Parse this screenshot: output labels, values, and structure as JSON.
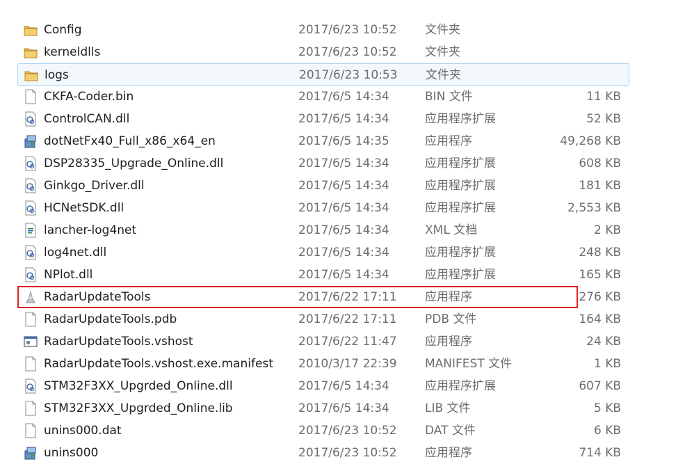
{
  "files": [
    {
      "name": "Config",
      "date": "2017/6/23 10:52",
      "type": "文件夹",
      "size": "",
      "icon": "folder-icon"
    },
    {
      "name": "kerneldlls",
      "date": "2017/6/23 10:52",
      "type": "文件夹",
      "size": "",
      "icon": "folder-icon"
    },
    {
      "name": "logs",
      "date": "2017/6/23 10:53",
      "type": "文件夹",
      "size": "",
      "icon": "folder-icon",
      "selected": true
    },
    {
      "name": "CKFA-Coder.bin",
      "date": "2017/6/5 14:34",
      "type": "BIN 文件",
      "size": "11 KB",
      "icon": "file-icon"
    },
    {
      "name": "ControlCAN.dll",
      "date": "2017/6/5 14:34",
      "type": "应用程序扩展",
      "size": "52 KB",
      "icon": "dll-icon"
    },
    {
      "name": "dotNetFx40_Full_x86_x64_en",
      "date": "2017/6/5 14:35",
      "type": "应用程序",
      "size": "49,268 KB",
      "icon": "installer-icon"
    },
    {
      "name": "DSP28335_Upgrade_Online.dll",
      "date": "2017/6/5 14:34",
      "type": "应用程序扩展",
      "size": "608 KB",
      "icon": "dll-icon"
    },
    {
      "name": "Ginkgo_Driver.dll",
      "date": "2017/6/5 14:34",
      "type": "应用程序扩展",
      "size": "181 KB",
      "icon": "dll-icon"
    },
    {
      "name": "HCNetSDK.dll",
      "date": "2017/6/5 14:34",
      "type": "应用程序扩展",
      "size": "2,553 KB",
      "icon": "dll-icon"
    },
    {
      "name": "lancher-log4net",
      "date": "2017/6/5 14:34",
      "type": "XML 文档",
      "size": "2 KB",
      "icon": "xml-icon"
    },
    {
      "name": "log4net.dll",
      "date": "2017/6/5 14:34",
      "type": "应用程序扩展",
      "size": "248 KB",
      "icon": "dll-icon"
    },
    {
      "name": "NPlot.dll",
      "date": "2017/6/5 14:34",
      "type": "应用程序扩展",
      "size": "165 KB",
      "icon": "dll-icon"
    },
    {
      "name": "RadarUpdateTools",
      "date": "2017/6/22 17:11",
      "type": "应用程序",
      "size": "276 KB",
      "icon": "app-icon",
      "highlighted": true
    },
    {
      "name": "RadarUpdateTools.pdb",
      "date": "2017/6/22 17:11",
      "type": "PDB 文件",
      "size": "164 KB",
      "icon": "file-icon"
    },
    {
      "name": "RadarUpdateTools.vshost",
      "date": "2017/6/22 11:47",
      "type": "应用程序",
      "size": "24 KB",
      "icon": "window-icon"
    },
    {
      "name": "RadarUpdateTools.vshost.exe.manifest",
      "date": "2010/3/17 22:39",
      "type": "MANIFEST 文件",
      "size": "1 KB",
      "icon": "file-icon"
    },
    {
      "name": "STM32F3XX_Upgrded_Online.dll",
      "date": "2017/6/5 14:34",
      "type": "应用程序扩展",
      "size": "607 KB",
      "icon": "dll-icon"
    },
    {
      "name": "STM32F3XX_Upgrded_Online.lib",
      "date": "2017/6/5 14:34",
      "type": "LIB 文件",
      "size": "5 KB",
      "icon": "file-icon"
    },
    {
      "name": "unins000.dat",
      "date": "2017/6/23 10:52",
      "type": "DAT 文件",
      "size": "6 KB",
      "icon": "file-icon"
    },
    {
      "name": "unins000",
      "date": "2017/6/23 10:52",
      "type": "应用程序",
      "size": "714 KB",
      "icon": "installer-icon"
    }
  ],
  "colors": {
    "selection_bg": "#f3f8fd",
    "selection_border": "#a7d4f5",
    "highlight_outline": "#e02020",
    "folder": "#e8b84a"
  }
}
